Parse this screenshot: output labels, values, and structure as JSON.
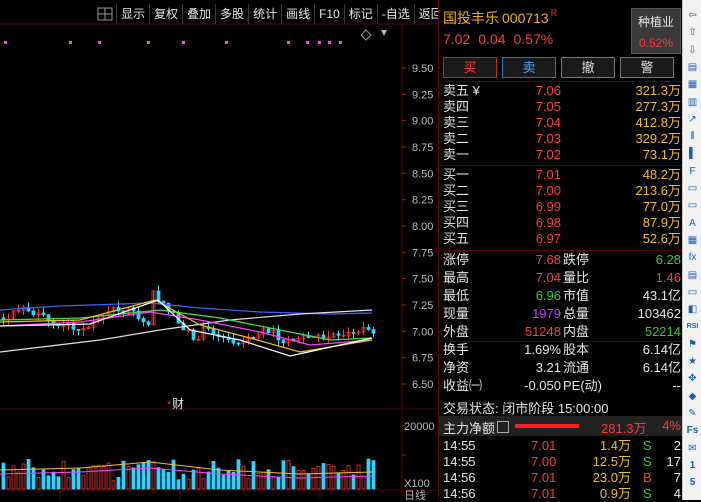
{
  "toolbar": {
    "buttons": [
      "显示",
      "复权",
      "叠加",
      "多股",
      "统计",
      "画线",
      "F10",
      "标记",
      "-自选",
      "返回"
    ]
  },
  "chart": {
    "price_axis": [
      "9.50",
      "9.25",
      "9.00",
      "8.75",
      "8.50",
      "8.25",
      "8.00",
      "7.75",
      "7.50",
      "7.25",
      "7.00",
      "6.75",
      "6.50"
    ],
    "volume_axis": [
      "20000",
      "X100"
    ],
    "markers": [
      "财"
    ],
    "bottom_label": "日线",
    "colors": {
      "ma5": "#ffffff",
      "ma10": "#f0c020",
      "ma20": "#ff40ff",
      "ma30": "#40e040",
      "ma60": "#4060ff",
      "ma120": "#e0e0e0",
      "up": "#ff3030",
      "down": "#30d0ff"
    }
  },
  "quote": {
    "name": "国投丰乐",
    "code": "000713",
    "flag": "R",
    "price": "7.02",
    "change": "0.04",
    "change_pct": "0.57%",
    "industry": {
      "name": "种植业",
      "pct": "0.52%"
    },
    "trade_buttons": [
      "买",
      "卖",
      "撤",
      "警"
    ],
    "sell": [
      {
        "label": "卖五",
        "mark": "¥",
        "price": "7.06",
        "vol": "321.3万"
      },
      {
        "label": "卖四",
        "mark": "",
        "price": "7.05",
        "vol": "277.3万"
      },
      {
        "label": "卖三",
        "mark": "",
        "price": "7.04",
        "vol": "412.8万"
      },
      {
        "label": "卖二",
        "mark": "",
        "price": "7.03",
        "vol": "329.2万"
      },
      {
        "label": "卖一",
        "mark": "",
        "price": "7.02",
        "vol": "73.1万"
      }
    ],
    "buy": [
      {
        "label": "买一",
        "price": "7.01",
        "vol": "48.2万",
        "pc": "red"
      },
      {
        "label": "买二",
        "price": "7.00",
        "vol": "213.6万",
        "pc": "red"
      },
      {
        "label": "买三",
        "price": "6.99",
        "vol": "77.0万",
        "pc": "red"
      },
      {
        "label": "买四",
        "price": "6.98",
        "vol": "87.9万",
        "pc": "white"
      },
      {
        "label": "买五",
        "price": "6.97",
        "vol": "52.6万",
        "pc": "green"
      }
    ],
    "stats1": [
      {
        "k1": "涨停",
        "v1": "7.68",
        "c1": "red",
        "k2": "跌停",
        "v2": "6.28",
        "c2": "green"
      },
      {
        "k1": "最高",
        "v1": "7.04",
        "c1": "red",
        "k2": "量比",
        "v2": "1.46",
        "c2": "red"
      },
      {
        "k1": "最低",
        "v1": "6.96",
        "c1": "green",
        "k2": "市值",
        "v2": "43.1亿",
        "c2": "white"
      },
      {
        "k1": "现量",
        "v1": "1979",
        "c1": "purple",
        "k2": "总量",
        "v2": "103462",
        "c2": "white"
      },
      {
        "k1": "外盘",
        "v1": "51248",
        "c1": "red",
        "k2": "内盘",
        "v2": "52214",
        "c2": "green"
      }
    ],
    "stats2": [
      {
        "k1": "换手",
        "v1": "1.69%",
        "c1": "white",
        "k2": "股本",
        "v2": "6.14亿",
        "c2": "white"
      },
      {
        "k1": "净资",
        "v1": "3.21",
        "c1": "white",
        "k2": "流通",
        "v2": "6.14亿",
        "c2": "white"
      },
      {
        "k1": "收益㈠",
        "v1": "-0.050",
        "c1": "white",
        "k2": "PE(动)",
        "v2": "--",
        "c2": "white"
      }
    ],
    "status": "交易状态: 闭市阶段 15:00:00",
    "flow": {
      "label": "主力净额",
      "value": "281.3万",
      "pct": "4%"
    },
    "ticks": [
      {
        "t": "14:55",
        "p": "7.01",
        "v": "1.4万",
        "d": "S",
        "dc": "green",
        "n": "2"
      },
      {
        "t": "14:55",
        "p": "7.00",
        "v": "12.5万",
        "d": "S",
        "dc": "green",
        "n": "17"
      },
      {
        "t": "14:56",
        "p": "7.01",
        "v": "23.0万",
        "d": "B",
        "dc": "red",
        "n": "7"
      },
      {
        "t": "14:56",
        "p": "7.01",
        "v": "0.9万",
        "d": "S",
        "dc": "green",
        "n": "4"
      }
    ]
  },
  "right_toolbar": {
    "icons": [
      "arrow-left-icon",
      "arrow-up-icon",
      "arrow-down-icon",
      "list-icon",
      "grid-icon",
      "bars-icon",
      "line-chart-icon",
      "kline-icon",
      "candle-icon",
      "f10-icon",
      "doc-icon",
      "doc2-icon",
      "text-icon",
      "calendar-icon",
      "fx-icon",
      "table-icon",
      "doc3-icon",
      "chart2-icon",
      "rsi-icon",
      "flag-icon",
      "star-icon",
      "move-icon",
      "diamond-icon",
      "pencil-icon",
      "fs-icon",
      "chat-icon",
      "num1-icon",
      "num5-icon"
    ],
    "labels": [
      "",
      "",
      "",
      "",
      "",
      "",
      "",
      "",
      "",
      "",
      "",
      "",
      "",
      "",
      "",
      "",
      "",
      "",
      "RSI",
      "",
      "",
      "",
      "",
      "",
      "Fs",
      "",
      "1",
      "5"
    ]
  }
}
